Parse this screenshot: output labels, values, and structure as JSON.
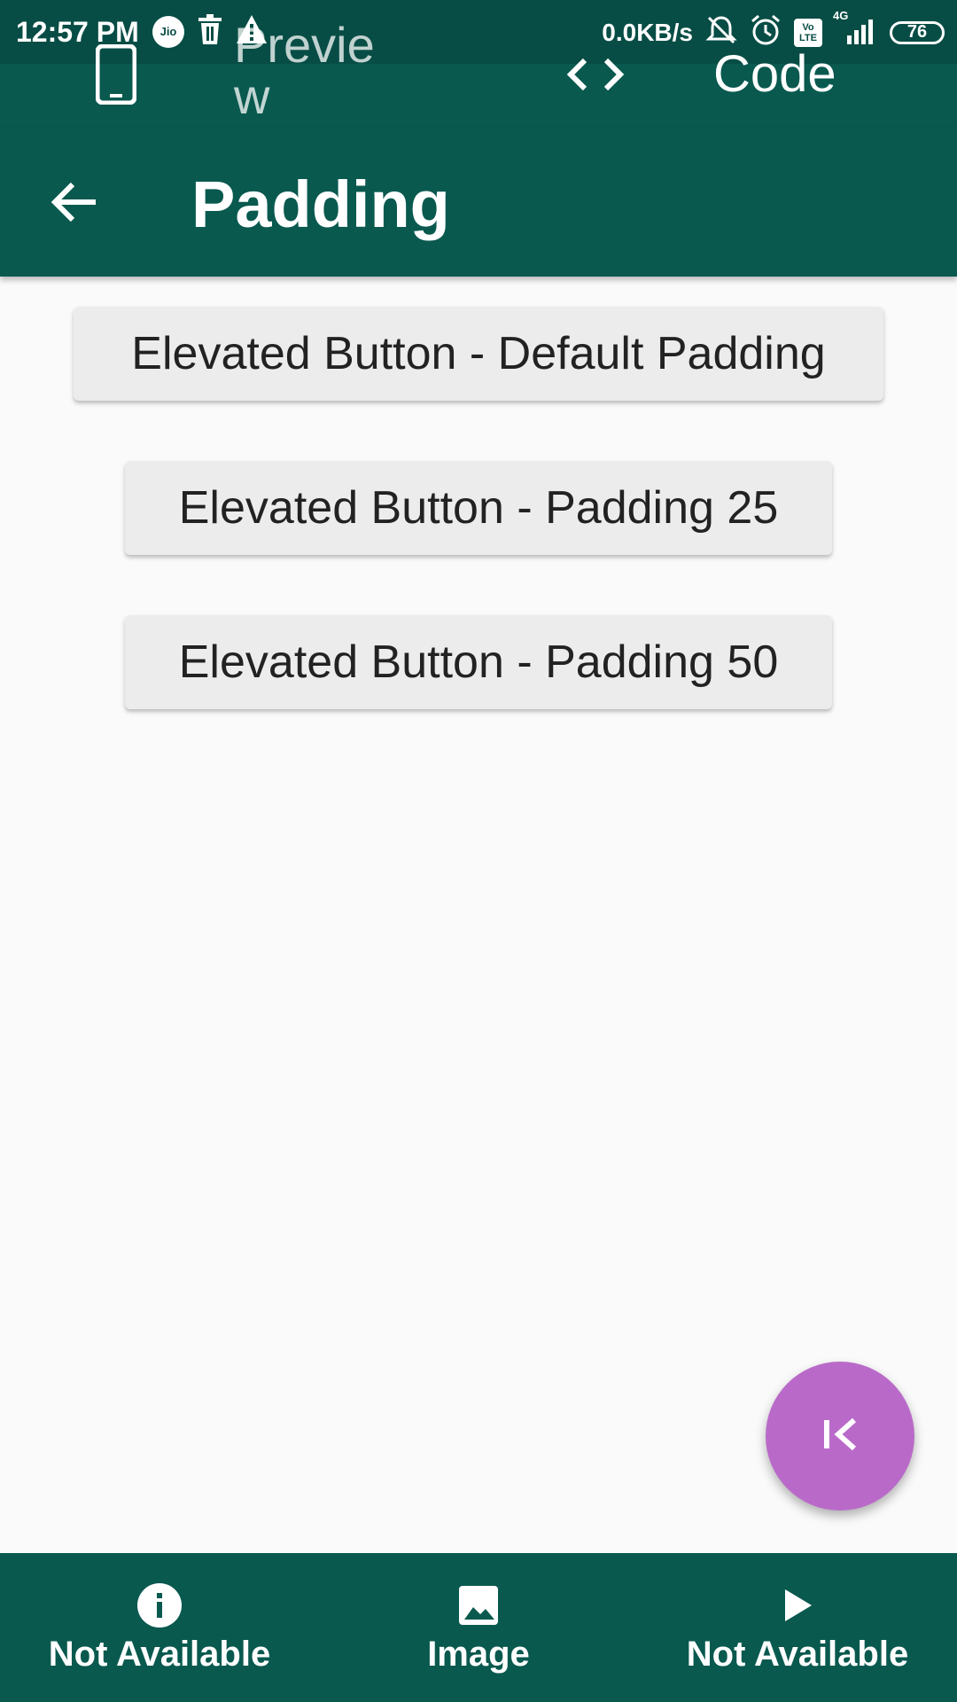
{
  "status_bar": {
    "time": "12:57 PM",
    "carrier_badge": "Jio",
    "network_speed": "0.0KB/s",
    "network_type": "4G",
    "volte_badge": "Vo LTE",
    "battery_level": "76"
  },
  "top_tabs": {
    "preview_label": "Preview",
    "code_label": "Code",
    "preview_icon": "phone-icon",
    "code_icon": "code-brackets-icon"
  },
  "app_bar": {
    "title": "Padding",
    "back_icon": "arrow-back-icon"
  },
  "buttons": [
    {
      "label": "Elevated Button - Default Padding"
    },
    {
      "label": "Elevated Button - Padding 25"
    },
    {
      "label": "Elevated Button - Padding 50"
    }
  ],
  "fab": {
    "icon": "first-page-icon",
    "color": "#b96ac9"
  },
  "bottom_nav": {
    "items": [
      {
        "label": "Not Available",
        "icon": "info-icon"
      },
      {
        "label": "Image",
        "icon": "image-icon"
      },
      {
        "label": "Not Available",
        "icon": "play-icon"
      }
    ]
  },
  "colors": {
    "primary": "#09594f",
    "status_bar": "#074d45",
    "background": "#fafafa",
    "button_bg": "#ececec",
    "accent": "#b96ac9"
  }
}
